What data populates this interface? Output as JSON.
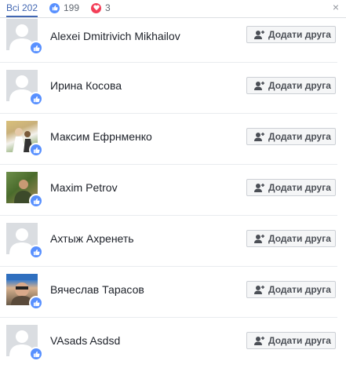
{
  "header": {
    "all_label": "Всі 202",
    "like_count": "199",
    "love_count": "3",
    "close_label": "×"
  },
  "colors": {
    "like": "#5890ff",
    "love": "#f33e58",
    "accent": "#4267b2"
  },
  "add_friend_label": "Додати друга",
  "people": [
    {
      "name": "Alexei Dmitrivich Mikhailov",
      "avatar": "default-silhouette"
    },
    {
      "name": "Ирина Косова",
      "avatar": "default-silhouette"
    },
    {
      "name": "Максим Ефрнменко",
      "avatar": "photo"
    },
    {
      "name": "Maxim Petrov",
      "avatar": "photo"
    },
    {
      "name": "Ахтыж Ахренеть",
      "avatar": "default-silhouette"
    },
    {
      "name": "Вячеслав Тарасов",
      "avatar": "photo"
    },
    {
      "name": "VAsads Asdsd",
      "avatar": "default-silhouette"
    }
  ]
}
